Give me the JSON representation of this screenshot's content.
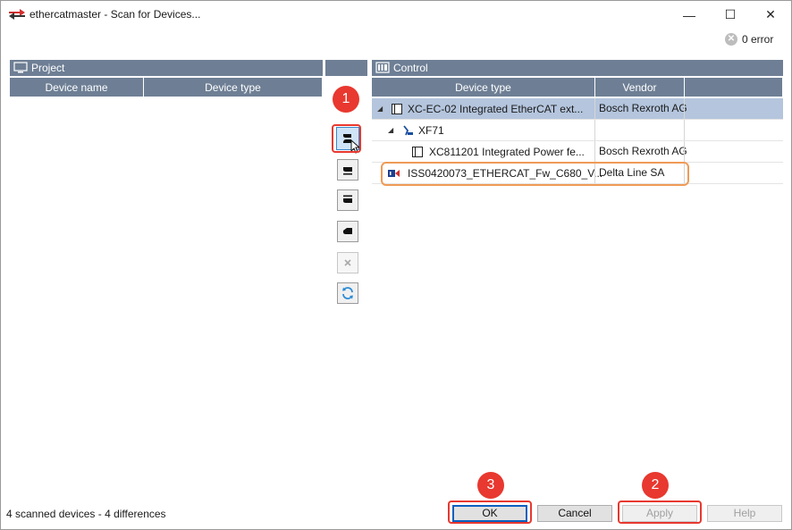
{
  "window": {
    "title": "ethercatmaster - Scan for Devices...",
    "minimize_glyph": "—",
    "maximize_glyph": "☐",
    "close_glyph": "✕"
  },
  "error_indicator": {
    "text": "0 error",
    "icon": "error-circle-icon"
  },
  "project_panel": {
    "title": "Project",
    "icon": "monitor-icon",
    "columns": [
      "Device name",
      "Device type"
    ]
  },
  "control_panel": {
    "title": "Control",
    "icon": "controller-icon",
    "columns": [
      "Device type",
      "Vendor"
    ],
    "rows": [
      {
        "type": "XC-EC-02 Integrated EtherCAT ext...",
        "vendor": "Bosch Rexroth AG",
        "icon": "device-module-icon",
        "expanded": true,
        "selected": true
      },
      {
        "type": "XF71",
        "vendor": "",
        "icon": "drive-axis-icon",
        "expanded": true,
        "selected": false
      },
      {
        "type": "XC811201 Integrated Power fe...",
        "vendor": "Bosch Rexroth AG",
        "icon": "device-module-icon",
        "expanded": false,
        "selected": false
      },
      {
        "type": "ISS0420073_ETHERCAT_Fw_C680_V...",
        "vendor": "Delta Line SA",
        "icon": "ethercat-device-icon",
        "expanded": false,
        "selected": false
      }
    ]
  },
  "tools": [
    {
      "name": "copy-device-button",
      "icon": "copy-to-project-icon",
      "active": true
    },
    {
      "name": "insert-below-button",
      "icon": "insert-below-icon",
      "active": false
    },
    {
      "name": "insert-above-button",
      "icon": "insert-above-icon",
      "active": false
    },
    {
      "name": "insert-child-button",
      "icon": "insert-child-icon",
      "active": false
    },
    {
      "name": "delete-button",
      "icon": "delete-icon",
      "active": false,
      "disabled": true
    },
    {
      "name": "refresh-button",
      "icon": "refresh-icon",
      "active": false
    }
  ],
  "callouts": [
    "1",
    "2",
    "3"
  ],
  "status": {
    "text": "4 scanned devices - 4 differences"
  },
  "buttons": {
    "ok": "OK",
    "cancel": "Cancel",
    "apply": "Apply",
    "help": "Help"
  },
  "colors": {
    "header": "#6e7f95",
    "selection": "#b4c5dd",
    "callout": "#e8382f",
    "highlight": "#ef9b57"
  }
}
